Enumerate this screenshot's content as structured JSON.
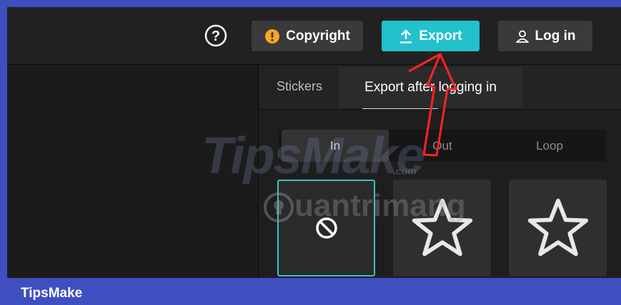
{
  "topbar": {
    "help_icon": "question-circle-icon",
    "copyright": {
      "label": "Copyright",
      "icon": "warning-circle-icon",
      "icon_color": "#f5a623"
    },
    "export": {
      "label": "Export",
      "icon": "upload-icon",
      "color": "#22c1cc"
    },
    "login": {
      "label": "Log in",
      "icon": "user-icon"
    }
  },
  "panel": {
    "tabs": [
      {
        "label": "Stickers"
      }
    ],
    "tooltip": "Export after logging in",
    "animation_tabs": [
      {
        "label": "In",
        "active": true
      },
      {
        "label": "Out",
        "active": false
      },
      {
        "label": "Loop",
        "active": false
      }
    ],
    "tiles": [
      {
        "icon": "none-icon",
        "selected": true
      },
      {
        "icon": "star-icon",
        "selected": false
      },
      {
        "icon": "star-icon",
        "selected": false
      }
    ]
  },
  "watermarks": {
    "tipsmake": "TipsMake",
    "tipsmake_suffix": ".com",
    "quantrimang": "uantrimang"
  },
  "footer": {
    "label": "TipsMake"
  }
}
